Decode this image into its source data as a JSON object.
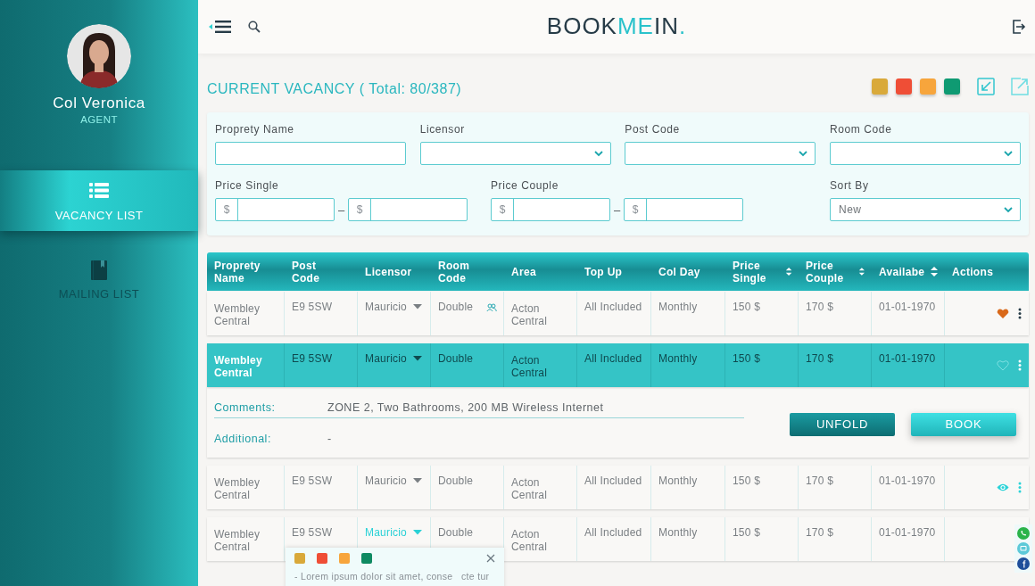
{
  "sidebar": {
    "user": {
      "name": "Col Veronica",
      "role": "AGENT"
    },
    "nav": [
      {
        "label": "VACANCY LIST",
        "selected": true
      },
      {
        "label": "MAILING LIST",
        "selected": false
      }
    ]
  },
  "header": {
    "logo": [
      {
        "text": "BOOK",
        "accent": false
      },
      {
        "text": "ME",
        "accent": true
      },
      {
        "text": "IN",
        "accent": false
      },
      {
        "text": ".",
        "accent": true
      }
    ]
  },
  "title": "CURRENT VACANCY ( Total: 80/387)",
  "legend": [
    {
      "color": "#d9a93a"
    },
    {
      "color": "#ef4e36"
    },
    {
      "color": "#f7a53c"
    },
    {
      "color": "#0f9a72"
    }
  ],
  "filters": [
    {
      "label": "Proprety Name",
      "kind": "text"
    },
    {
      "label": "Licensor",
      "kind": "select"
    },
    {
      "label": "Post Code",
      "kind": "select"
    },
    {
      "label": "Room Code",
      "kind": "select"
    },
    {
      "label": "Price Single",
      "kind": "range",
      "min_prefix": "$",
      "separator": "–",
      "max_prefix": "$"
    },
    {
      "label": "Price Couple",
      "kind": "range",
      "min_prefix": "$",
      "separator": "–",
      "max_prefix": "$"
    },
    {
      "label": "Sort By",
      "kind": "select",
      "value": "New"
    }
  ],
  "table": {
    "columns": [
      {
        "label": "Proprety Name"
      },
      {
        "label": "Post Code"
      },
      {
        "label": "Licensor"
      },
      {
        "label": "Room Code"
      },
      {
        "label": "Area"
      },
      {
        "label": "Top Up"
      },
      {
        "label": "Col Day"
      },
      {
        "label": "Price Single",
        "sortable": true
      },
      {
        "label": "Price Couple",
        "sortable": true
      },
      {
        "label": "Availabe",
        "sortable": true
      },
      {
        "label": "Actions"
      }
    ],
    "rows": [
      {
        "name": "Wembley Central",
        "post_code": "E9 5SW",
        "licensor": "Mauricio",
        "licensor_highlight": false,
        "room_code": "Double",
        "shared": true,
        "area": "Acton Central",
        "top_up": "All Included",
        "col_day": "Monthly",
        "price_single": "150 $",
        "price_couple": "170 $",
        "available": "01-01-1970",
        "kind": "favorite",
        "favorite": true,
        "selected": false
      },
      {
        "name": "Wembley Central",
        "post_code": "E9 5SW",
        "licensor": "Mauricio",
        "licensor_highlight": false,
        "room_code": "Double",
        "area": "Acton Central",
        "top_up": "All Included",
        "col_day": "Monthly",
        "price_single": "150 $",
        "price_couple": "170 $",
        "available": "01-01-1970",
        "kind": "favorite",
        "favorite": false,
        "selected": true,
        "details": {
          "comments_label": "Comments:",
          "comments": "ZONE 2, Two Bathrooms, 200 MB Wireless Internet",
          "additional_label": "Additional:",
          "additional": "-",
          "buttons": [
            {
              "label": "UNFOLD",
              "kind": "dark"
            },
            {
              "label": "BOOK",
              "kind": "light"
            }
          ]
        }
      },
      {
        "name": "Wembley Central",
        "post_code": "E9 5SW",
        "licensor": "Mauricio",
        "licensor_highlight": false,
        "room_code": "Double",
        "area": "Acton Central",
        "top_up": "All Included",
        "col_day": "Monthly",
        "price_single": "150 $",
        "price_couple": "170 $",
        "available": "01-01-1970",
        "kind": "view",
        "selected": false
      },
      {
        "name": "Wembley Central",
        "post_code": "E9 5SW",
        "licensor": "Mauricio",
        "licensor_highlight": true,
        "room_code": "Double",
        "area": "Acton Central",
        "top_up": "All Included",
        "col_day": "Monthly",
        "price_single": "150 $",
        "price_couple": "170 $",
        "available": "01-01-1970",
        "selected": false,
        "note": {
          "colors": [
            {
              "color": "#d9a93a"
            },
            {
              "color": "#ef4e36"
            },
            {
              "color": "#f7a53c"
            },
            {
              "color": "#0f8a62"
            }
          ],
          "text": "- Lorem ipsum dolor sit amet, conse   cte tur"
        }
      }
    ]
  }
}
